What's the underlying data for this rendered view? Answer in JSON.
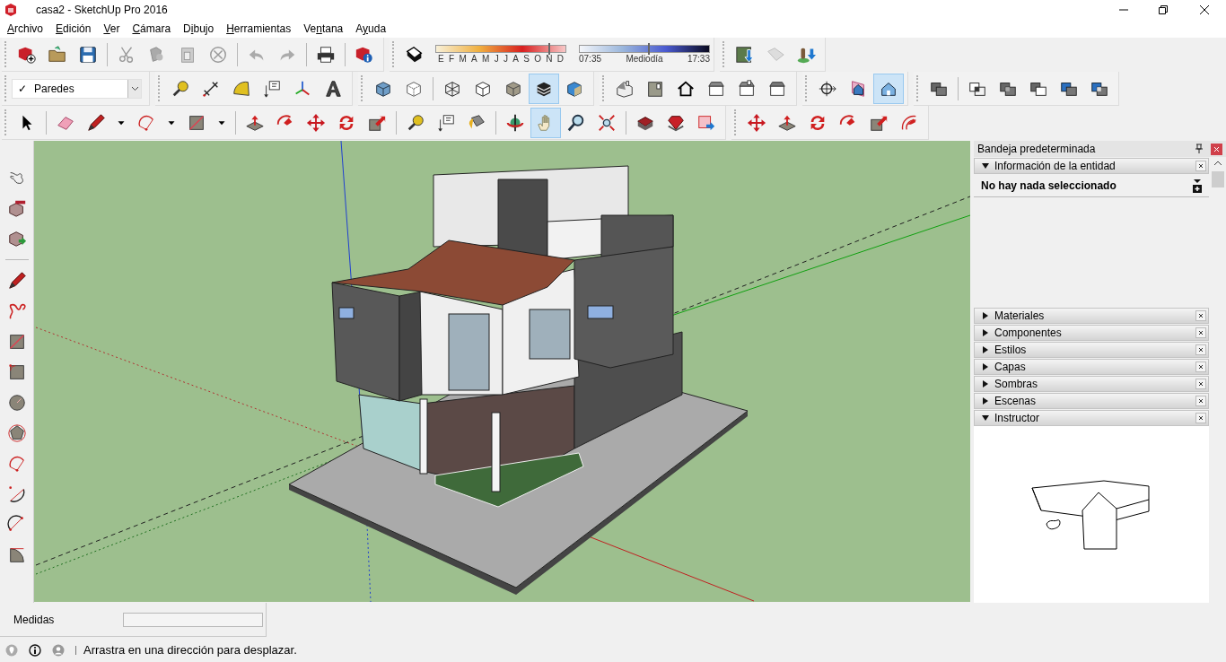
{
  "window": {
    "title": "casa2 - SketchUp Pro 2016"
  },
  "menu": [
    {
      "key": "A",
      "rest": "rchivo"
    },
    {
      "key": "E",
      "rest": "dición"
    },
    {
      "key": "V",
      "rest": "er"
    },
    {
      "key": "C",
      "rest": "ámara"
    },
    {
      "lead": "D",
      "key": "i",
      "rest": "bujo"
    },
    {
      "key": "H",
      "rest": "erramientas"
    },
    {
      "lead": "Ve",
      "key": "n",
      "rest": "tana"
    },
    {
      "lead": "A",
      "key": "y",
      "rest": "uda"
    }
  ],
  "toolbar_rows": [
    [
      {
        "kind": "buttons",
        "groups": [
          [
            {
              "kind": "new",
              "selected": false
            },
            {
              "kind": "open",
              "selected": false
            },
            {
              "kind": "save",
              "selected": false
            }
          ],
          [
            {
              "kind": "cut",
              "selected": false
            },
            {
              "kind": "copy",
              "selected": false
            },
            {
              "kind": "paste",
              "selected": false
            },
            {
              "kind": "erase",
              "selected": false
            }
          ],
          [
            {
              "kind": "undo",
              "selected": false
            },
            {
              "kind": "redo",
              "selected": false
            }
          ],
          [
            {
              "kind": "print",
              "selected": false
            }
          ],
          [
            {
              "kind": "info",
              "selected": false
            }
          ]
        ]
      },
      {
        "kind": "shadows",
        "toggle": {
          "kind": "shadowcube",
          "selected": false
        },
        "months": [
          "E",
          "F",
          "M",
          "A",
          "M",
          "J",
          "J",
          "A",
          "S",
          "O",
          "N",
          "D"
        ],
        "month_slider": {
          "level": 0.87
        },
        "time_start": "07:35",
        "time_mid": "Mediodía",
        "time_end": "17:33",
        "time_slider": {
          "level": 0.53
        }
      },
      {
        "kind": "buttons",
        "groups": [
          [
            {
              "kind": "getmodels",
              "selected": false
            },
            {
              "kind": "share",
              "selected": false
            },
            {
              "kind": "figure",
              "selected": false
            }
          ]
        ]
      }
    ],
    [
      {
        "kind": "layers",
        "layer": {
          "mark": "✓",
          "name": "Paredes"
        }
      },
      {
        "kind": "buttons",
        "groups": [
          [
            {
              "kind": "tape",
              "selected": false
            },
            {
              "kind": "dimension",
              "selected": false
            },
            {
              "kind": "protractor",
              "selected": false
            },
            {
              "kind": "label",
              "selected": false
            },
            {
              "kind": "axes",
              "selected": false
            },
            {
              "kind": "text3d",
              "selected": false
            }
          ]
        ]
      },
      {
        "kind": "buttons",
        "groups": [
          [
            {
              "kind": "xray",
              "selected": false
            },
            {
              "kind": "backedges",
              "selected": false
            }
          ],
          [
            {
              "kind": "wireframe",
              "selected": false
            },
            {
              "kind": "hiddenline",
              "selected": false
            },
            {
              "kind": "shaded",
              "selected": false
            },
            {
              "kind": "textured",
              "selected": true
            },
            {
              "kind": "monochrome",
              "selected": false
            }
          ]
        ]
      },
      {
        "kind": "buttons",
        "groups": [
          [
            {
              "kind": "iso",
              "selected": false
            },
            {
              "kind": "top",
              "selected": false
            },
            {
              "kind": "front",
              "selected": false
            },
            {
              "kind": "right",
              "selected": false
            },
            {
              "kind": "back",
              "selected": false
            },
            {
              "kind": "left",
              "selected": false
            }
          ]
        ]
      },
      {
        "kind": "buttons",
        "groups": [
          [
            {
              "kind": "sectionplane",
              "selected": false
            },
            {
              "kind": "sectionshow",
              "selected": false
            },
            {
              "kind": "sectioncut",
              "selected": true
            }
          ]
        ]
      },
      {
        "kind": "buttons",
        "groups": [
          [
            {
              "kind": "outershell",
              "selected": false
            }
          ],
          [
            {
              "kind": "union",
              "selected": false
            },
            {
              "kind": "intersect",
              "selected": false
            },
            {
              "kind": "subtract",
              "selected": false
            },
            {
              "kind": "trim",
              "selected": false
            },
            {
              "kind": "split",
              "selected": false
            }
          ]
        ]
      }
    ],
    [
      {
        "kind": "buttons",
        "groups": [
          [
            {
              "kind": "select",
              "selected": false
            }
          ],
          [
            {
              "kind": "eraser",
              "selected": false
            },
            {
              "kind": "pencil",
              "selected": false
            },
            {
              "kind": "caret",
              "selected": false
            },
            {
              "kind": "arc",
              "selected": false
            },
            {
              "kind": "caret",
              "selected": false
            },
            {
              "kind": "rect",
              "selected": false
            },
            {
              "kind": "caret",
              "selected": false
            }
          ],
          [
            {
              "kind": "pushpull",
              "selected": false
            },
            {
              "kind": "followme",
              "selected": false
            },
            {
              "kind": "move",
              "selected": false
            },
            {
              "kind": "rotate",
              "selected": false
            },
            {
              "kind": "scale",
              "selected": false
            }
          ],
          [
            {
              "kind": "tape",
              "selected": false
            },
            {
              "kind": "label",
              "selected": false
            },
            {
              "kind": "paint",
              "selected": false
            }
          ],
          [
            {
              "kind": "orbit",
              "selected": false
            },
            {
              "kind": "pan",
              "selected": true
            },
            {
              "kind": "zoom",
              "selected": false
            },
            {
              "kind": "zoomext",
              "selected": false
            }
          ],
          [
            {
              "kind": "wh1",
              "selected": false
            },
            {
              "kind": "wh2",
              "selected": false
            },
            {
              "kind": "wh3",
              "selected": false
            }
          ]
        ]
      },
      {
        "kind": "buttons",
        "groups": [
          [
            {
              "kind": "move",
              "selected": false
            },
            {
              "kind": "pushpull",
              "selected": false
            },
            {
              "kind": "rotate",
              "selected": false
            },
            {
              "kind": "followme",
              "selected": false
            },
            {
              "kind": "scale",
              "selected": false
            },
            {
              "kind": "offset",
              "selected": false
            }
          ]
        ]
      }
    ]
  ],
  "side_toolbar": {
    "groups": [
      [
        {
          "kind": "walk",
          "selected": false
        },
        {
          "kind": "comp1",
          "selected": false
        },
        {
          "kind": "comp2",
          "selected": false
        }
      ],
      [
        {
          "kind": "pencil",
          "selected": false
        },
        {
          "kind": "freehand",
          "selected": false
        },
        {
          "kind": "rect",
          "selected": false
        },
        {
          "kind": "rotrect",
          "selected": false
        },
        {
          "kind": "circle",
          "selected": false
        },
        {
          "kind": "polygon",
          "selected": false
        },
        {
          "kind": "arc",
          "selected": false
        },
        {
          "kind": "arc2",
          "selected": false
        },
        {
          "kind": "arc3",
          "selected": false
        },
        {
          "kind": "pie",
          "selected": false
        }
      ]
    ]
  },
  "tray": {
    "title": "Bandeja predeterminada",
    "panels": [
      {
        "kind": "entity",
        "title": "Información de la entidad",
        "expanded": true,
        "message": "No hay nada seleccionado"
      },
      {
        "title": "Materiales",
        "expanded": false
      },
      {
        "title": "Componentes",
        "expanded": false
      },
      {
        "title": "Estilos",
        "expanded": false
      },
      {
        "title": "Capas",
        "expanded": false
      },
      {
        "title": "Sombras",
        "expanded": false
      },
      {
        "title": "Escenas",
        "expanded": false
      },
      {
        "kind": "instructor",
        "title": "Instructor",
        "expanded": true
      }
    ]
  },
  "measurements": {
    "label": "Medidas"
  },
  "status_bar": {
    "message": "Arrastra en una dirección para desplazar."
  }
}
